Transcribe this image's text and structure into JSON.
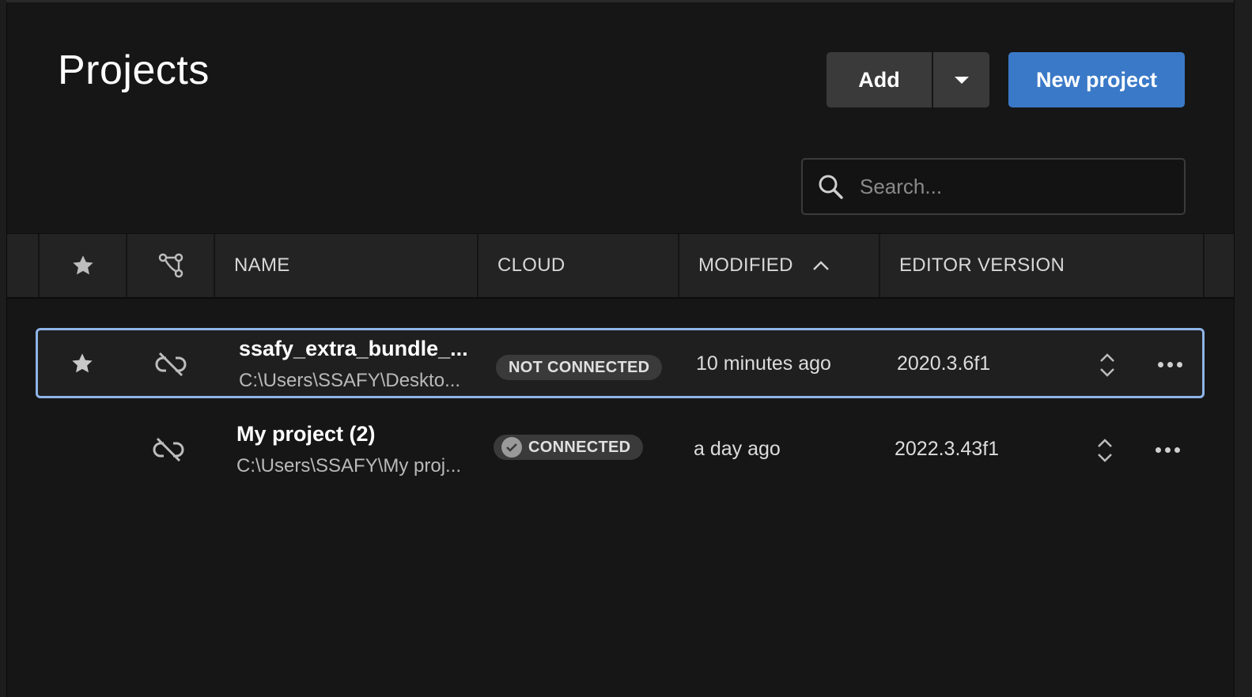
{
  "header": {
    "title": "Projects",
    "add_label": "Add",
    "new_project_label": "New project"
  },
  "search": {
    "placeholder": "Search...",
    "value": ""
  },
  "table": {
    "columns": {
      "favorite": "star-icon",
      "source_control": "branch-icon",
      "name": "NAME",
      "cloud": "CLOUD",
      "modified": "MODIFIED",
      "editor_version": "EDITOR VERSION"
    },
    "sort": {
      "column": "MODIFIED",
      "direction": "ascending"
    },
    "rows": [
      {
        "favorite": true,
        "selected": true,
        "name": "ssafy_extra_bundle_...",
        "path": "C:\\Users\\SSAFY\\Deskto...",
        "cloud": "NOT CONNECTED",
        "modified": "10 minutes ago",
        "version": "2020.3.6f1"
      },
      {
        "favorite": false,
        "selected": false,
        "name": "My project (2)",
        "path": "C:\\Users\\SSAFY\\My proj...",
        "cloud": "CONNECTED",
        "modified": "a day ago",
        "version": "2022.3.43f1"
      }
    ]
  },
  "colors": {
    "accent": "#3a79c7",
    "selection_border": "#8fb4e8",
    "background": "#161616"
  }
}
